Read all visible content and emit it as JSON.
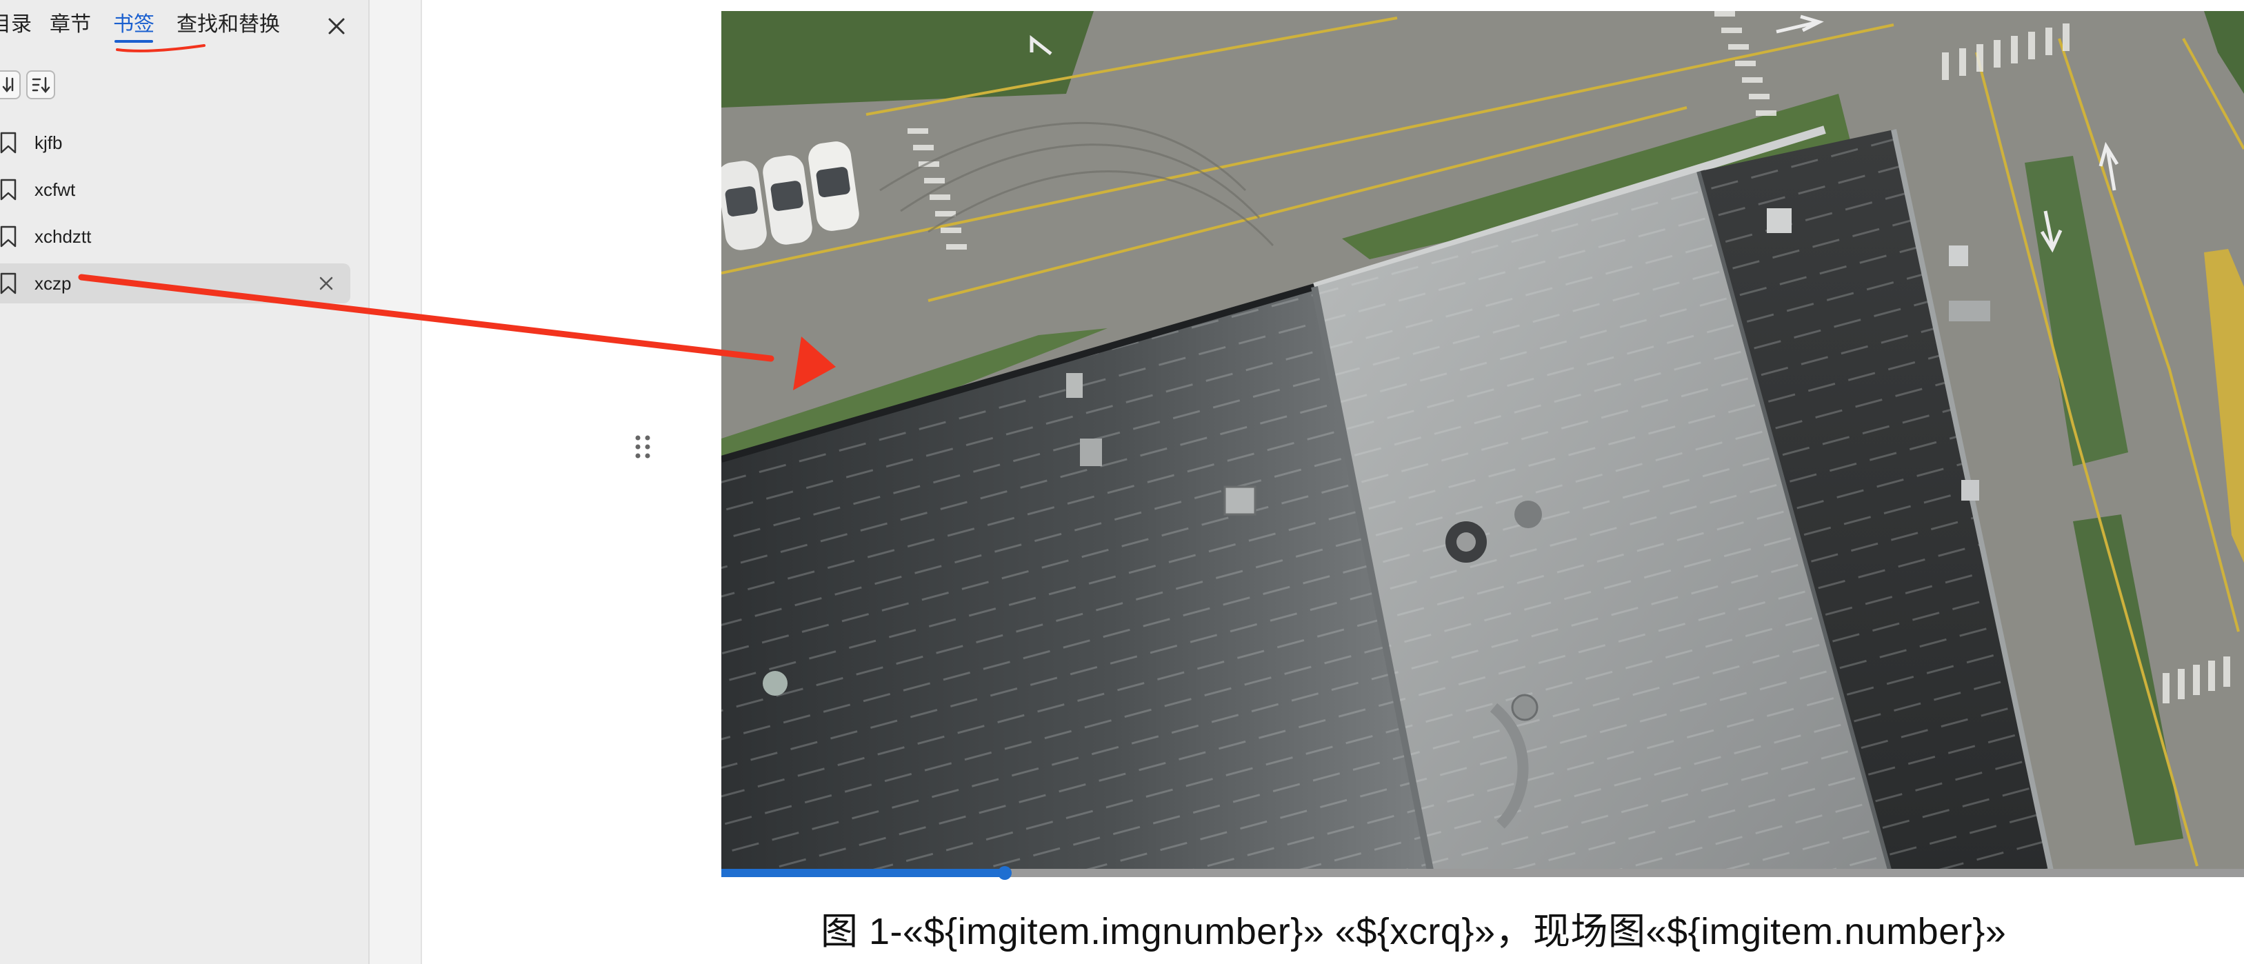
{
  "sidebar": {
    "tabs": [
      {
        "label": "目录"
      },
      {
        "label": "章节"
      },
      {
        "label": "书签"
      },
      {
        "label": "查找和替换"
      }
    ],
    "active_tab": "书签",
    "bookmarks": [
      {
        "label": "kjfb"
      },
      {
        "label": "xcfwt"
      },
      {
        "label": "xchdztt"
      },
      {
        "label": "xczp"
      }
    ]
  },
  "document": {
    "caption": "图 1-«${imgitem.imgnumber}» «${xcrq}»，现场图«${imgitem.number}»",
    "video_progress": 0.186
  },
  "colors": {
    "accent": "#1a5fcf",
    "annotation_red": "#f2331d",
    "progress_blue": "#1f6fd1"
  },
  "icons": [
    "close-icon",
    "sort-descending-icon",
    "sort-order-icon",
    "bookmark-icon",
    "drag-handle-icon"
  ]
}
